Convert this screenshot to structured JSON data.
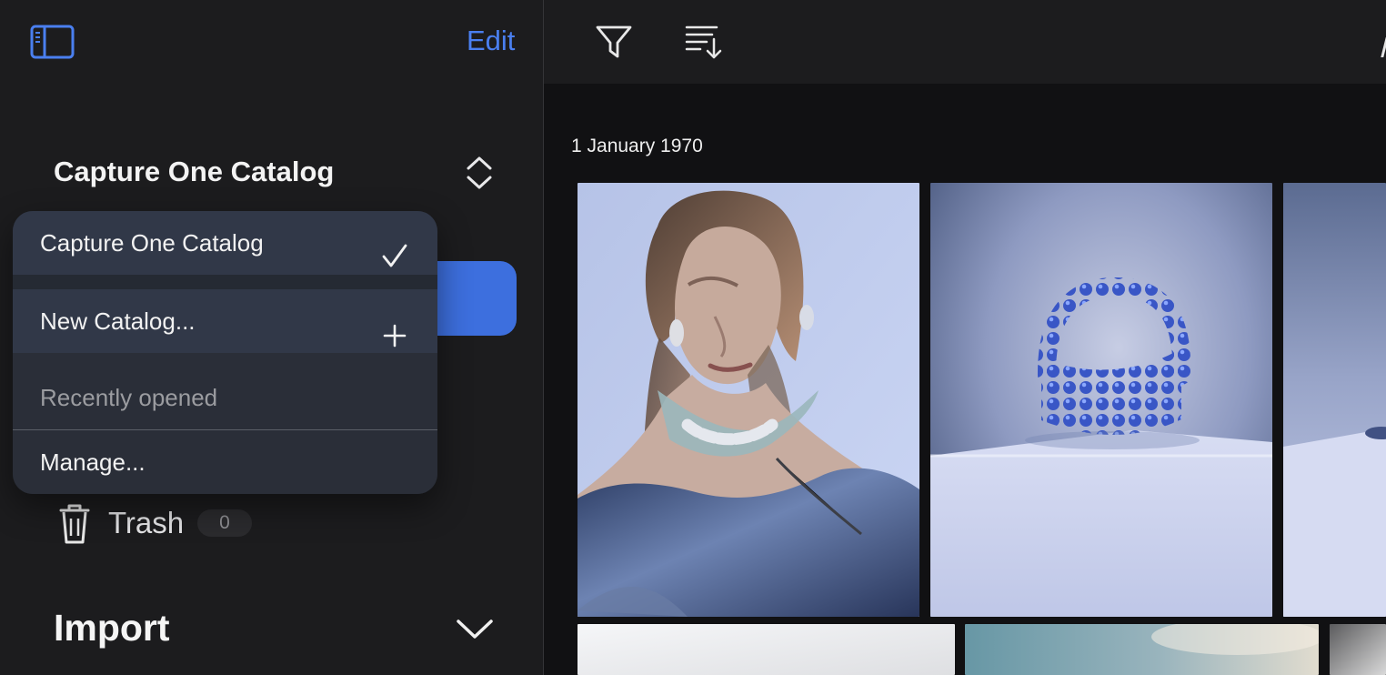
{
  "sidebar": {
    "toggle_icon": "sidebar-toggle-icon",
    "edit_label": "Edit",
    "catalog_title": "Capture One Catalog",
    "trash_label": "Trash",
    "trash_count": "0",
    "import_label": "Import"
  },
  "catalog_menu": {
    "current_catalog": "Capture One Catalog",
    "new_catalog": "New Catalog...",
    "recently_opened": "Recently opened",
    "manage": "Manage..."
  },
  "toolbar": {
    "filter_icon": "filter-icon",
    "sort_icon": "sort-icon"
  },
  "browser": {
    "date_header": "1 January 1970",
    "thumbnails": [
      {
        "name": "portrait-with-necklace"
      },
      {
        "name": "blue-beaded-bag-on-pedestal"
      },
      {
        "name": "partial-blue-product-image"
      },
      {
        "name": "light-gray-image"
      },
      {
        "name": "sky-image"
      },
      {
        "name": "dark-gradient-image"
      }
    ]
  },
  "colors": {
    "accent": "#4a7ff0",
    "selection": "#3d6fde",
    "sidebar_background": "#1c1c1e",
    "content_background": "#111113",
    "popover_background": "#2a2e38"
  }
}
